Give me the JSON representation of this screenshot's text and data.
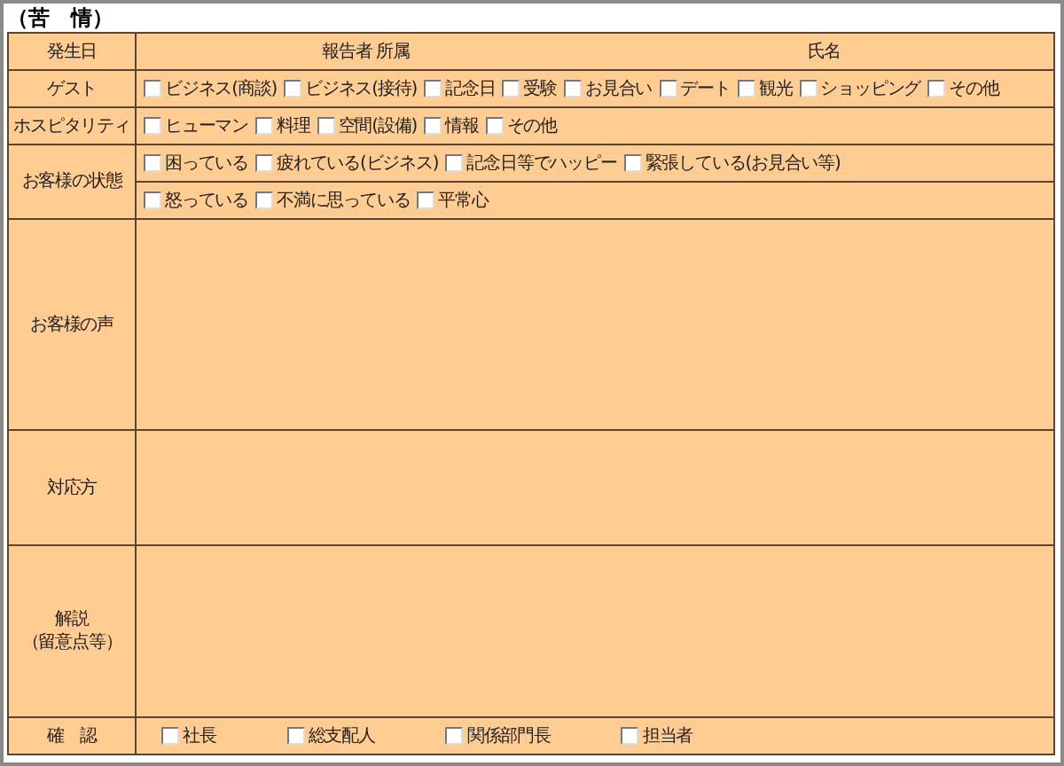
{
  "title": "（苦　情）",
  "header": {
    "label": "発生日",
    "reporter_label": "報告者 所属",
    "name_label": "氏名"
  },
  "rows": [
    {
      "kind": "checks",
      "label": "ゲスト",
      "lines": [
        [
          {
            "label": "ビジネス(商談)",
            "checked": false
          },
          {
            "label": "ビジネス(接待)",
            "checked": false
          },
          {
            "label": "記念日",
            "checked": false
          },
          {
            "label": "受験",
            "checked": false
          },
          {
            "label": "お見合い",
            "checked": false
          },
          {
            "label": "デート",
            "checked": false
          },
          {
            "label": "観光",
            "checked": false
          },
          {
            "label": "ショッピング",
            "checked": false
          },
          {
            "label": "その他",
            "checked": false
          }
        ]
      ]
    },
    {
      "kind": "checks",
      "label": "ホスピタリティ",
      "lines": [
        [
          {
            "label": "ヒューマン",
            "checked": false
          },
          {
            "label": "料理",
            "checked": false
          },
          {
            "label": "空間(設備)",
            "checked": false
          },
          {
            "label": "情報",
            "checked": false
          },
          {
            "label": "その他",
            "checked": false
          }
        ]
      ]
    },
    {
      "kind": "checks",
      "label": "お客様の状態",
      "lines": [
        [
          {
            "label": "困っている",
            "checked": false
          },
          {
            "label": "疲れている(ビジネス)",
            "checked": false
          },
          {
            "label": "記念日等でハッピー",
            "checked": false
          },
          {
            "label": "緊張している(お見合い等)",
            "checked": false
          }
        ],
        [
          {
            "label": "怒っている",
            "checked": false
          },
          {
            "label": "不満に思っている",
            "checked": false
          },
          {
            "label": "平常心",
            "checked": false
          }
        ]
      ]
    },
    {
      "kind": "blank",
      "label": "お客様の声"
    },
    {
      "kind": "blank",
      "label": "対応方"
    },
    {
      "kind": "blank",
      "label": "解説",
      "sublabel": "（留意点等）"
    },
    {
      "kind": "signoff",
      "label": "確　認",
      "lines": [
        [
          {
            "label": "社長",
            "checked": false
          },
          {
            "label": "総支配人",
            "checked": false
          },
          {
            "label": "関係部門長",
            "checked": false
          },
          {
            "label": "担当者",
            "checked": false
          }
        ]
      ]
    }
  ]
}
